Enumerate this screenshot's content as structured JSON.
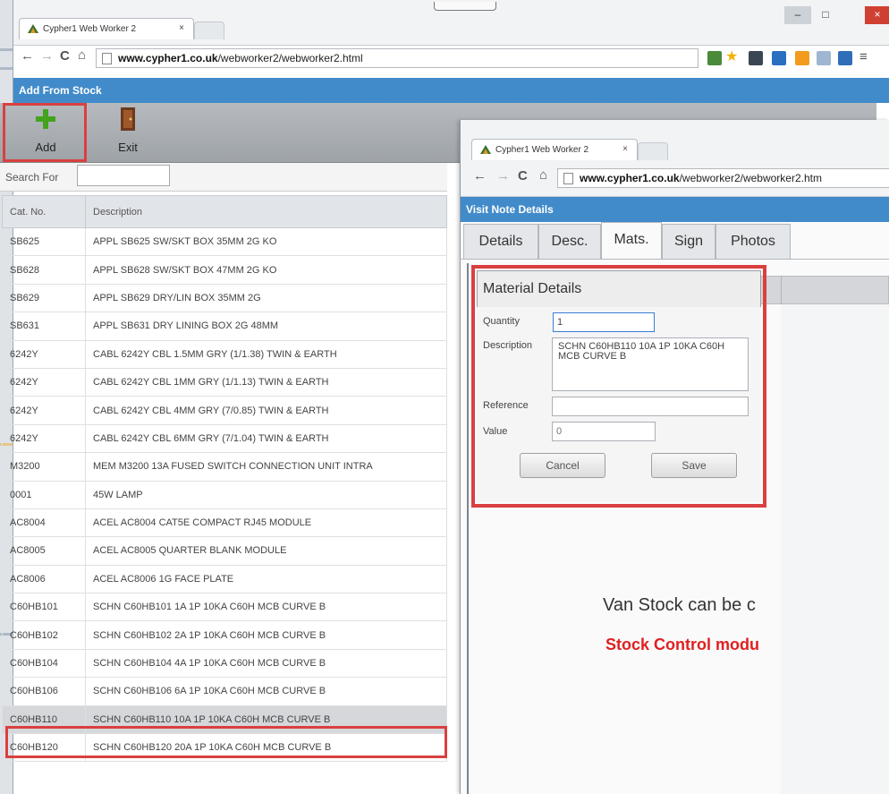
{
  "main_window": {
    "tab_title": "Cypher1 Web Worker 2",
    "tab_close": "×",
    "url_host": "www.cypher1.co.uk",
    "url_path": "/webworker2/webworker2.html",
    "nav": {
      "back": "←",
      "forward": "→",
      "reload": "C",
      "home": "⌂"
    },
    "window_controls": {
      "minimize": "–",
      "maximize": "□",
      "close": "×"
    },
    "page_title": "Add From Stock",
    "toolbar": {
      "add_label": "Add",
      "exit_label": "Exit"
    },
    "search": {
      "label": "Search For",
      "value": ""
    },
    "table": {
      "headers": [
        "Cat. No.",
        "Description"
      ],
      "rows": [
        [
          "SB625",
          "APPL SB625 SW/SKT BOX 35MM 2G KO"
        ],
        [
          "SB628",
          "APPL SB628 SW/SKT BOX 47MM 2G KO"
        ],
        [
          "SB629",
          "APPL SB629 DRY/LIN BOX 35MM 2G"
        ],
        [
          "SB631",
          "APPL SB631 DRY LINING BOX 2G 48MM"
        ],
        [
          "6242Y",
          "CABL 6242Y CBL 1.5MM GRY (1/1.38) TWIN & EARTH"
        ],
        [
          "6242Y",
          "CABL 6242Y CBL 1MM GRY (1/1.13) TWIN & EARTH"
        ],
        [
          "6242Y",
          "CABL 6242Y CBL 4MM GRY (7/0.85) TWIN & EARTH"
        ],
        [
          "6242Y",
          "CABL 6242Y CBL 6MM GRY (7/1.04) TWIN & EARTH"
        ],
        [
          "M3200",
          "MEM  M3200 13A FUSED SWITCH CONNECTION UNIT INTRA"
        ],
        [
          "0001",
          "45W LAMP"
        ],
        [
          "AC8004",
          "ACEL AC8004 CAT5E COMPACT RJ45 MODULE"
        ],
        [
          "AC8005",
          "ACEL AC8005 QUARTER BLANK MODULE"
        ],
        [
          "AC8006",
          "ACEL AC8006 1G FACE PLATE"
        ],
        [
          "C60HB101",
          "SCHN C60HB101 1A 1P 10KA C60H MCB CURVE B"
        ],
        [
          "C60HB102",
          "SCHN C60HB102 2A 1P 10KA C60H MCB CURVE B"
        ],
        [
          "C60HB104",
          "SCHN C60HB104 4A 1P 10KA C60H MCB CURVE B"
        ],
        [
          "C60HB106",
          "SCHN C60HB106 6A 1P 10KA C60H MCB CURVE B"
        ],
        [
          "C60HB110",
          "SCHN C60HB110 10A 1P 10KA C60H MCB CURVE B"
        ],
        [
          "C60HB120",
          "SCHN C60HB120 20A 1P 10KA C60H MCB CURVE B"
        ]
      ],
      "selected_index": 17
    }
  },
  "second_window": {
    "tab_title": "Cypher1 Web Worker 2",
    "tab_close": "×",
    "url_host": "www.cypher1.co.uk",
    "url_path": "/webworker2/webworker2.htm",
    "nav": {
      "back": "←",
      "forward": "→",
      "reload": "C",
      "home": "⌂"
    },
    "page_title": "Visit Note Details",
    "tabs": [
      "Details",
      "Desc.",
      "Mats.",
      "Sign",
      "Photos"
    ],
    "active_tab": "Mats.",
    "material_dialog": {
      "title": "Material Details",
      "quantity_label": "Quantity",
      "quantity_value": "1",
      "description_label": "Description",
      "description_value": "SCHN C60HB110 10A 1P 10KA C60H MCB CURVE B",
      "reference_label": "Reference",
      "reference_value": "",
      "value_label": "Value",
      "value_placeholder": "0",
      "cancel_label": "Cancel",
      "save_label": "Save"
    }
  },
  "caption": {
    "line1": "Van Stock can be c",
    "line2": "Stock Control modu"
  },
  "colors": {
    "accent_blue": "#428bca",
    "highlight_red": "#d9403f",
    "caption_red": "#e02020"
  }
}
